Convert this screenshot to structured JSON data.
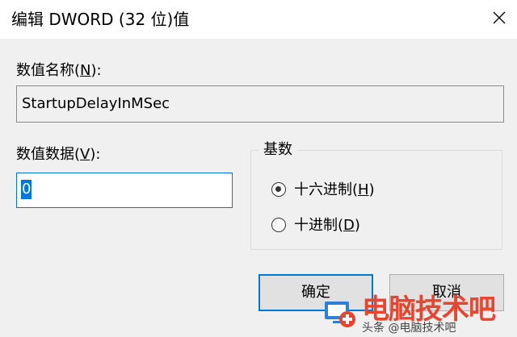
{
  "window": {
    "title": "编辑 DWORD (32 位)值"
  },
  "value_name": {
    "label": "数值名称(N):",
    "label_pre": "数值名称(",
    "label_key": "N",
    "label_post": "):",
    "value": "StartupDelayInMSec"
  },
  "value_data": {
    "label": "数值数据(V):",
    "label_pre": "数值数据(",
    "label_key": "V",
    "label_post": "):",
    "value": "0"
  },
  "base": {
    "title": "基数",
    "options": [
      {
        "label": "十六进制(H)",
        "label_pre": "十六进制(",
        "label_key": "H",
        "label_post": ")",
        "selected": true
      },
      {
        "label": "十进制(D)",
        "label_pre": "十进制(",
        "label_key": "D",
        "label_post": ")",
        "selected": false
      }
    ]
  },
  "buttons": {
    "ok": "确定",
    "cancel": "取消"
  },
  "watermark": {
    "brand": "电脑技术吧",
    "caption": "头条 @电脑技术吧"
  },
  "colors": {
    "accent": "#0078d7",
    "watermark": "#e8442e"
  }
}
